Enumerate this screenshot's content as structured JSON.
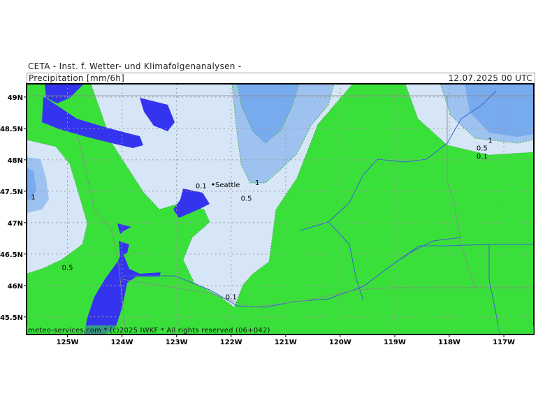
{
  "header": {
    "organization": "CETA - Inst. f. Wetter- und Klimafolgenanalysen -",
    "title": "Precipitation [mm/6h]",
    "datetime": "12.07.2025 00 UTC"
  },
  "footer": {
    "credit": "meteo-services.com * (c)2025 IWKF * All rights reserved (06+042)"
  },
  "map": {
    "lat_labels": [
      "49N",
      "48.5N",
      "48N",
      "47.5N",
      "47N",
      "46.5N",
      "46N",
      "45.5N"
    ],
    "lon_labels": [
      "125W",
      "124W",
      "123W",
      "122W",
      "121W",
      "120W",
      "119W",
      "118W",
      "117W"
    ],
    "city": "Seattle",
    "colors": {
      "lt_0_1": "#3ae03a",
      "c_0_1_0_5": "#d6e6f7",
      "c_0_5_1": "#9ec2ef",
      "c_gt_1": "#78aaee",
      "water": "#3434ee",
      "rivers": "#3a5fd8",
      "borders": "#888888"
    },
    "contour_labels": [
      {
        "text": "0.1",
        "lon": -122.55,
        "lat": 47.55
      },
      {
        "text": "1",
        "lon": -121.52,
        "lat": 47.6
      },
      {
        "text": "0.5",
        "lon": -121.72,
        "lat": 47.35
      },
      {
        "text": "1",
        "lon": -125.63,
        "lat": 47.37
      },
      {
        "text": "0.5",
        "lon": -125.0,
        "lat": 46.25
      },
      {
        "text": "0.1",
        "lon": -122.0,
        "lat": 45.78
      },
      {
        "text": "1",
        "lon": -117.25,
        "lat": 48.27
      },
      {
        "text": "0.5",
        "lon": -117.4,
        "lat": 48.15
      },
      {
        "text": "0.1",
        "lon": -117.4,
        "lat": 48.02
      }
    ]
  }
}
